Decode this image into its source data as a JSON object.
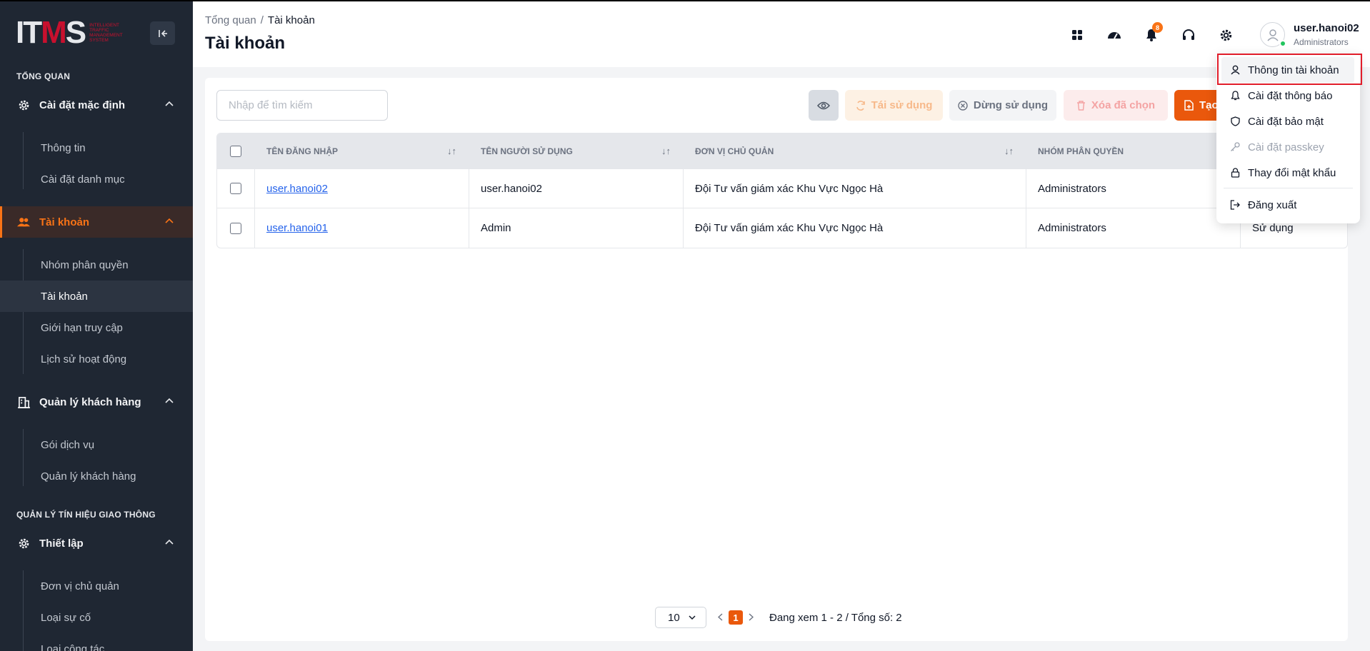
{
  "brand": {
    "mark_white": "IT",
    "mark_red": "M",
    "mark_white2": "S",
    "tagline": "Intelligent Traffic Management System"
  },
  "sidebar": {
    "section1": "TỔNG QUAN",
    "section2": "QUẢN LÝ TÍN HIỆU GIAO THÔNG",
    "groups": [
      {
        "label": "Cài đặt mặc định",
        "icon": "gear-icon",
        "items": [
          "Thông tin",
          "Cài đặt danh mục"
        ]
      },
      {
        "label": "Tài khoản",
        "icon": "users-icon",
        "active": true,
        "items": [
          "Nhóm phân quyền",
          "Tài khoản",
          "Giới hạn truy cập",
          "Lịch sử hoạt động"
        ]
      },
      {
        "label": "Quản lý khách hàng",
        "icon": "building-icon",
        "items": [
          "Gói dịch vụ",
          "Quản lý khách hàng"
        ]
      },
      {
        "label": "Thiết lập",
        "icon": "gear-icon",
        "items": [
          "Đơn vị chủ quản",
          "Loại sự cố",
          "Loại công tác"
        ]
      }
    ]
  },
  "header": {
    "breadcrumb": [
      "Tổng quan",
      "Tài khoản"
    ],
    "title": "Tài khoản",
    "notification_count": "8",
    "user": {
      "name": "user.hanoi02",
      "role": "Administrators"
    }
  },
  "toolbar": {
    "search_placeholder": "Nhập để tìm kiếm",
    "reuse": "Tái sử dụng",
    "stop": "Dừng sử dụng",
    "delete": "Xóa đã chọn",
    "create": "Tạo"
  },
  "table": {
    "columns": [
      "TÊN ĐĂNG NHẬP",
      "TÊN NGƯỜI SỬ DỤNG",
      "ĐƠN VỊ CHỦ QUẢN",
      "NHÓM PHÂN QUYỀN"
    ],
    "rows": [
      {
        "username": "user.hanoi02",
        "fullname": "user.hanoi02",
        "unit": "Đội Tư vấn giám xác Khu Vực Ngọc Hà",
        "group": "Administrators",
        "status": ""
      },
      {
        "username": "user.hanoi01",
        "fullname": "Admin",
        "unit": "Đội Tư vấn giám xác Khu Vực Ngọc Hà",
        "group": "Administrators",
        "status": "Sử dụng"
      }
    ]
  },
  "pagination": {
    "page_size": "10",
    "current_page": "1",
    "info": "Đang xem 1 - 2 / Tổng số: 2"
  },
  "user_menu": {
    "items": [
      "Thông tin tài khoản",
      "Cài đặt thông báo",
      "Cài đặt bảo mật",
      "Cài đặt passkey",
      "Thay đổi mật khẩu",
      "Đăng xuất"
    ]
  },
  "colors": {
    "sidebar_bg": "#1f2733",
    "accent": "#ea580c",
    "highlight_box": "#e11d2a"
  }
}
